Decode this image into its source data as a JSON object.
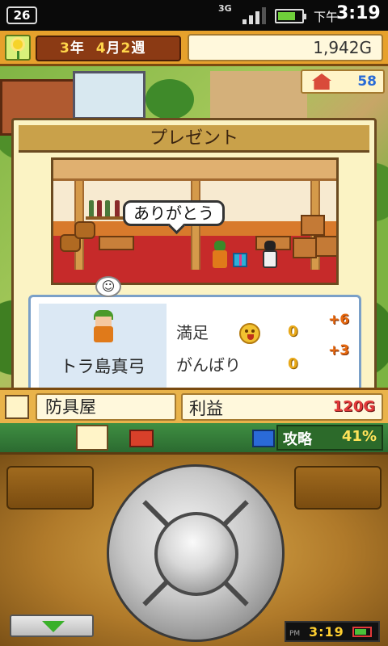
{
  "status_bar": {
    "notification_count": "26",
    "network": "3G",
    "ampm": "下午",
    "time": "3:19",
    "battery_level": 0.75,
    "signal_level": 0.75,
    "icons": [
      "signal-icon",
      "battery-icon"
    ]
  },
  "hud": {
    "season_icon": "flower-icon",
    "year_num": "3",
    "year_unit": "年",
    "month_num": "4",
    "month_unit": "月",
    "week_num": "2",
    "week_unit": "週",
    "gold": "1,942G",
    "building_count": "58"
  },
  "dialog": {
    "title": "プレゼント",
    "speech": "ありがとう",
    "character_name": "トラ島真弓",
    "mood_icon": "smile-bubble-icon",
    "stats": [
      {
        "label": "満足",
        "icon": "happy-face-icon",
        "value": "0",
        "delta": "+6"
      },
      {
        "label": "がんばり",
        "value": "0",
        "delta": "+3"
      }
    ]
  },
  "shop_bar": {
    "shop_name": "防具屋",
    "profit_label": "利益",
    "profit_value": "120G"
  },
  "bottom_bar": {
    "progress_label": "攻略",
    "progress_value": "41%",
    "progress_fraction": 0.41
  },
  "controller": {
    "mini_ampm": "PM",
    "mini_time": "3:19",
    "mini_battery_level": 0.8
  },
  "colors": {
    "hud_orange": "#e6a12c",
    "dialog_bg": "#fbf3c4",
    "profit_red": "#e23a3a",
    "stat_orange": "#e86a10"
  }
}
